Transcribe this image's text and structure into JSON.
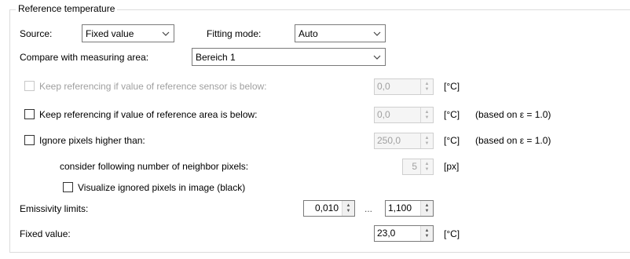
{
  "group": {
    "title": "Reference temperature"
  },
  "source": {
    "label": "Source:",
    "value": "Fixed value"
  },
  "fitting": {
    "label": "Fitting mode:",
    "value": "Auto"
  },
  "compare": {
    "label": "Compare with measuring area:",
    "value": "Bereich 1"
  },
  "ref_sensor": {
    "label": "Keep referencing if value of reference sensor is below:",
    "value": "0,0",
    "unit": "[°C]",
    "checked": false,
    "enabled": false
  },
  "ref_area": {
    "label": "Keep referencing if value of reference area is below:",
    "value": "0,0",
    "unit": "[°C]",
    "note": "(based on ε = 1.0)",
    "checked": false
  },
  "ignore": {
    "label": "Ignore pixels higher than:",
    "value": "250,0",
    "unit": "[°C]",
    "note": "(based on ε = 1.0)",
    "checked": false
  },
  "neighbor": {
    "label": "consider following number of neighbor pixels:",
    "value": "5",
    "unit": "[px]"
  },
  "visualize": {
    "label": "Visualize ignored pixels in image (black)",
    "checked": false
  },
  "emissivity": {
    "label": "Emissivity limits:",
    "min": "0,010",
    "sep": "...",
    "max": "1,100"
  },
  "fixed": {
    "label": "Fixed value:",
    "value": "23,0",
    "unit": "[°C]"
  }
}
